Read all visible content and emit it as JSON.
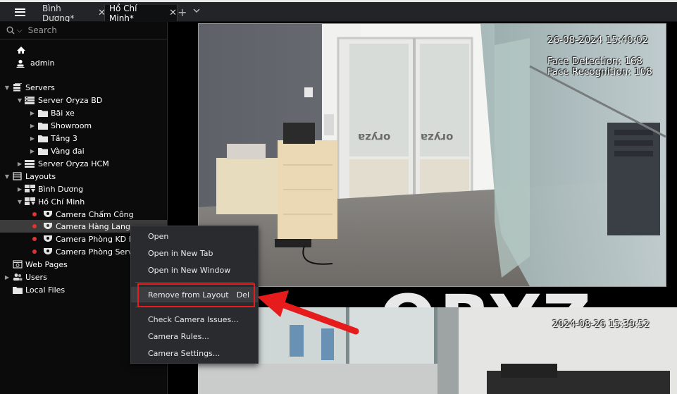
{
  "tabs": [
    {
      "label": "Bình Dương*",
      "close": "✕"
    },
    {
      "label": "Hồ Chí Minh*",
      "close": "✕"
    }
  ],
  "tab_new": "+",
  "search": {
    "placeholder": "Search"
  },
  "user": {
    "name": "admin"
  },
  "tree": {
    "servers": "Servers",
    "server_bd": "Server Oryza BD",
    "bai_xe": "Bãi xe",
    "showroom": "Showroom",
    "tang3": "Tầng 3",
    "vang_dai": "Vàng đai",
    "server_hcm": "Server Oryza HCM",
    "layouts": "Layouts",
    "layout_bd": "Bình Dương",
    "layout_hcm": "Hồ Chí Minh",
    "cam1": "Camera Chấm Công",
    "cam2": "Camera Hàng Lang",
    "cam3": "Camera Phòng KD HCM",
    "cam4": "Camera Phòng Server",
    "web_pages": "Web Pages",
    "users": "Users",
    "local_files": "Local Files"
  },
  "video1": {
    "timestamp": "26-08-2024 15:40:02",
    "face_detection": "Face Detection: 168",
    "face_recognition": "Face Recognition: 108",
    "door_logo_left": "oryza",
    "door_logo_right": "oryza"
  },
  "video2": {
    "timestamp": "2024-08-26 15:39:52"
  },
  "background_logo": "ORYZ",
  "context_menu": {
    "open": "Open",
    "open_new_tab": "Open in New Tab",
    "open_new_window": "Open in New Window",
    "remove_from_layout": "Remove from Layout",
    "remove_shortcut": "Del",
    "check_issues": "Check Camera Issues...",
    "camera_rules": "Camera Rules...",
    "camera_settings": "Camera Settings..."
  },
  "colors": {
    "annotation_red": "#e61b1b",
    "status_dot_red": "#e23232",
    "sidebar_bg": "#0b0b0c",
    "menu_bg": "#2a2b2e"
  }
}
